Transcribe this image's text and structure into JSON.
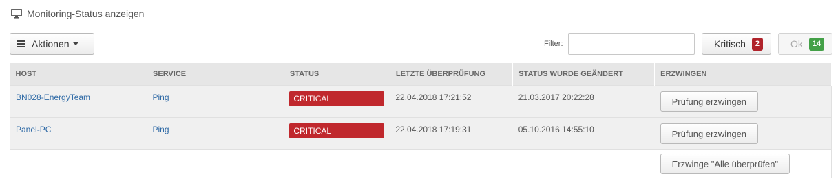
{
  "header": {
    "title": "Monitoring-Status anzeigen",
    "icon": "monitor-icon"
  },
  "toolbar": {
    "actions_label": "Aktionen",
    "filter_label": "Filter:",
    "filter_value": "",
    "critical_label": "Kritisch",
    "critical_count": "2",
    "ok_label": "Ok",
    "ok_count": "14"
  },
  "table": {
    "columns": [
      "HOST",
      "SERVICE",
      "STATUS",
      "LETZTE ÜBERPRÜFUNG",
      "STATUS WURDE GEÄNDERT",
      "ERZWINGEN"
    ],
    "rows": [
      {
        "host": "BN028-EnergyTeam",
        "service": "Ping",
        "status": "CRITICAL",
        "last_check": "22.04.2018 17:21:52",
        "changed": "21.03.2017 20:22:28",
        "force_label": "Prüfung erzwingen"
      },
      {
        "host": "Panel-PC",
        "service": "Ping",
        "status": "CRITICAL",
        "last_check": "22.04.2018 17:19:31",
        "changed": "05.10.2016 14:55:10",
        "force_label": "Prüfung erzwingen"
      }
    ],
    "force_all_label": "Erzwinge \"Alle überprüfen\""
  },
  "colors": {
    "critical": "#c0282d",
    "ok_badge": "#43a047",
    "link": "#2f6aa6"
  }
}
